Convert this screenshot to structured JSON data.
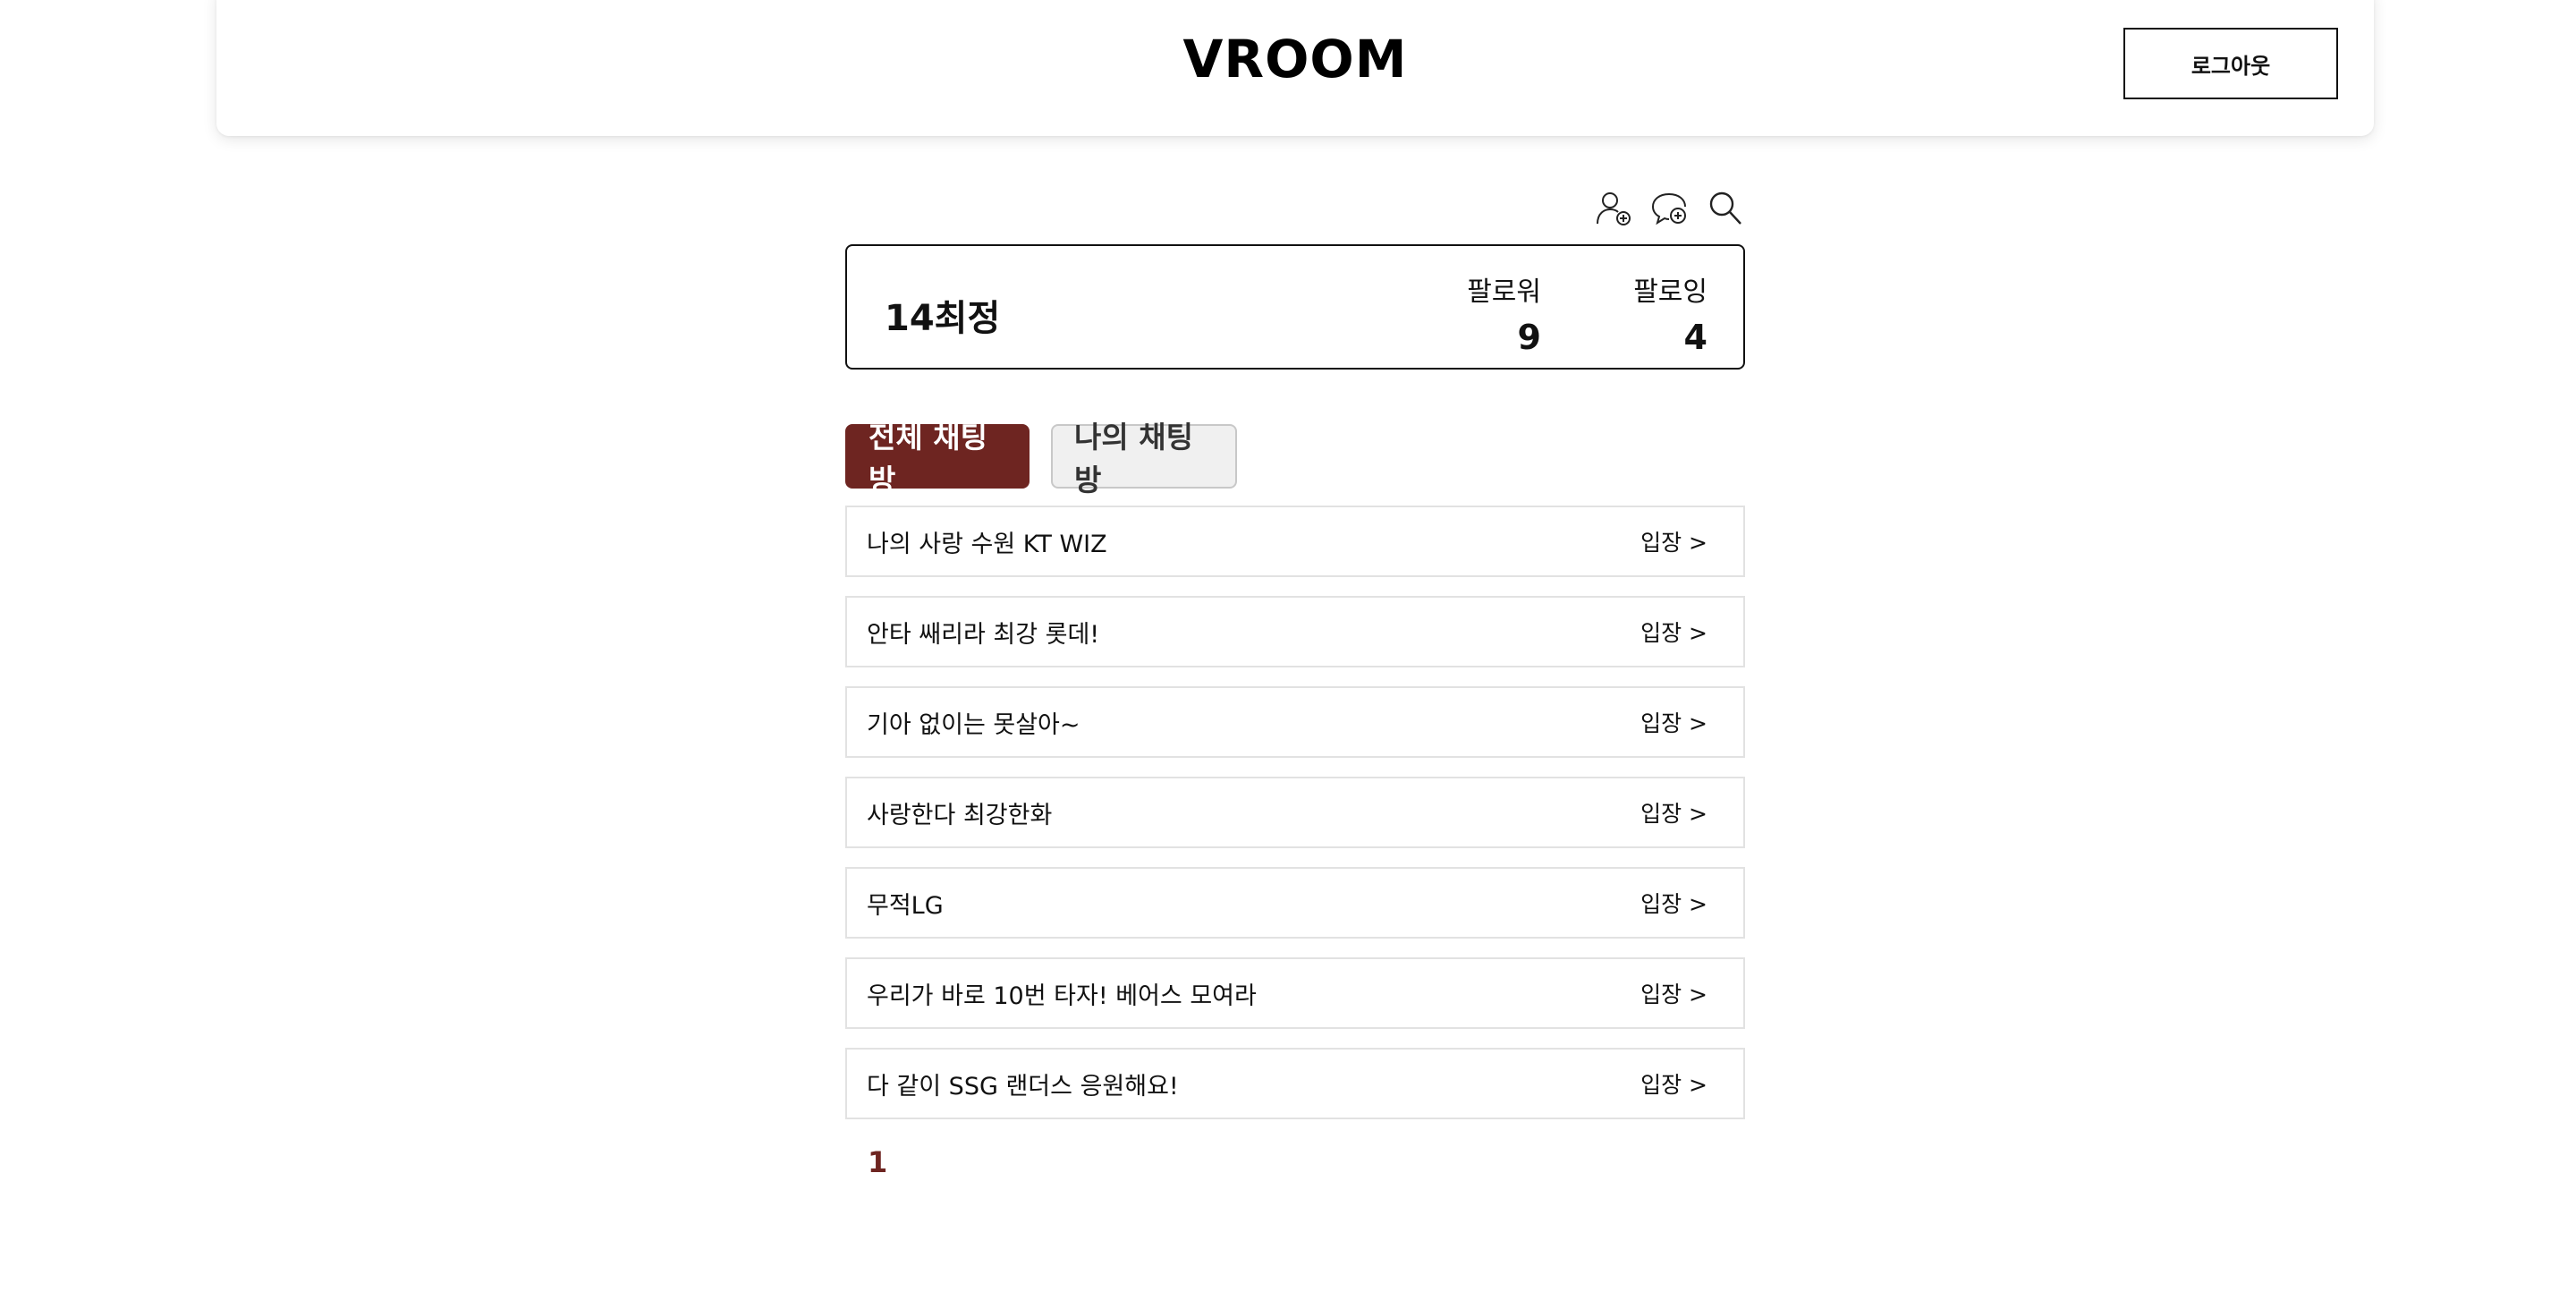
{
  "header": {
    "logo": "VROOM",
    "logout_label": "로그아웃"
  },
  "toolbar": {
    "icons": [
      "add-user-icon",
      "add-chat-icon",
      "search-icon"
    ]
  },
  "profile": {
    "nickname": "14최정",
    "followers_label": "팔로워",
    "followers_count": "9",
    "following_label": "팔로잉",
    "following_count": "4"
  },
  "tabs": [
    {
      "label": "전체 채팅방",
      "active": true
    },
    {
      "label": "나의 채팅방",
      "active": false
    }
  ],
  "rooms": [
    {
      "name": "나의 사랑 수원 KT WIZ",
      "enter": "입장 >"
    },
    {
      "name": "안타 쌔리라 최강 롯데!",
      "enter": "입장 >"
    },
    {
      "name": "기아 없이는 못살아~",
      "enter": "입장 >"
    },
    {
      "name": "사랑한다 최강한화",
      "enter": "입장 >"
    },
    {
      "name": "무적LG",
      "enter": "입장 >"
    },
    {
      "name": "우리가 바로 10번 타자! 베어스 모여라",
      "enter": "입장 >"
    },
    {
      "name": "다 같이 SSG 랜더스 응원해요!",
      "enter": "입장 >"
    }
  ],
  "pagination": {
    "current": "1"
  },
  "colors": {
    "accent": "#6e2521",
    "inactive_tab_bg": "#f0f0f0",
    "border": "#e2e2e2"
  }
}
